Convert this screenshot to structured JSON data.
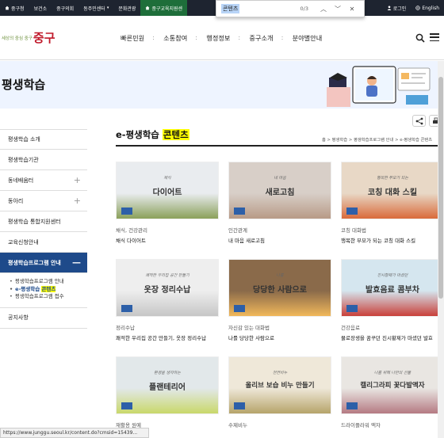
{
  "topbar": {
    "items": [
      "중구청",
      "보건소",
      "중구의회",
      "동주민센터",
      "문화관광",
      "중구교육지원센"
    ],
    "active_index": 5,
    "login": "로그인",
    "language": "English"
  },
  "find": {
    "query": "콘텐츠",
    "count": "0/3"
  },
  "header": {
    "logo_small": "세상의 중심 중구",
    "logo_big": "중구",
    "nav": [
      "빠른민원",
      "소통참여",
      "행정정보",
      "중구소개",
      "분야별안내"
    ]
  },
  "banner": {
    "title": "평생학습"
  },
  "sidebar": {
    "items": [
      {
        "label": "평생학습 소개",
        "plus": false
      },
      {
        "label": "평생학습기관",
        "plus": false
      },
      {
        "label": "동네배움터",
        "plus": true
      },
      {
        "label": "동아리",
        "plus": true
      },
      {
        "label": "평생학습 통합지원센터",
        "plus": false
      },
      {
        "label": "교육신청안내",
        "plus": false
      }
    ],
    "active": {
      "label": "평생학습프로그램 안내",
      "toggle": "—"
    },
    "sub": [
      {
        "label": "평생학습프로그램 안내"
      },
      {
        "label_pre": "e-평생학습 ",
        "label_hl": "콘텐츠"
      },
      {
        "label": "평생학습프로그램 접수"
      }
    ],
    "last": "공지사항"
  },
  "content": {
    "title_pre": "e-평생학습 ",
    "title_hl": "콘텐츠",
    "breadcrumb": "홈 > 평생학습 > 평생학습프로그램 안내 > e-평생학습 콘텐츠"
  },
  "cards": [
    {
      "cat": "채식, 건강관리",
      "name": "채식 다이어트",
      "cap": "다이어트",
      "small": "채식",
      "bg": "#e9ecef",
      "accent": "#8aa05a"
    },
    {
      "cat": "인간관계",
      "name": "내 마음 새로고침",
      "cap": "새로고침",
      "small": "내 마음",
      "bg": "#d8cfc8",
      "accent": "#b89a86"
    },
    {
      "cat": "코칭 대화법",
      "name": "행복한 부모가 되는 코칭 대화 스킬",
      "cap": "코칭 대화 스킬",
      "small": "행복한 부모가 되는",
      "bg": "#e8d8c6",
      "accent": "#d96a3a"
    },
    {
      "cat": "정리수납",
      "name": "쾌적한 우리집 공간 만들기, 옷장 정리수납",
      "cap": "옷장 정리수납",
      "small": "쾌적한 우리집 공간 만들기",
      "bg": "#eeeeee",
      "accent": "#c6c6c6"
    },
    {
      "cat": "자신감 있는 대화법",
      "name": "나를 당당한 사람으로",
      "cap": "당당한 사람으로",
      "small": "나를",
      "bg": "#8a6a4a",
      "accent": "#f1b85a"
    },
    {
      "cat": "건강음료",
      "name": "물로장생을 꿈꾸던 진시황제가 마셨던 발효",
      "cap": "발효음료 콤부차",
      "small": "진시황제가 마셨던",
      "bg": "#d5e6ef",
      "accent": "#c9403a"
    },
    {
      "cat": "재활용 원예",
      "name": "",
      "cap": "플랜테리어",
      "small": "환경을 생각하는",
      "bg": "#e2e8ea",
      "accent": "#c9d86a"
    },
    {
      "cat": "수제비누",
      "name": "",
      "cap": "올리브 보습 비누 만들기",
      "small": "천연비누",
      "bg": "#efe8d9",
      "accent": "#b6a46a"
    },
    {
      "cat": "드라이플라워 액자",
      "name": "",
      "cap": "캘리그라피 꽃다발액자",
      "small": "나를 위해 나만의 선물",
      "bg": "#e9e6e2",
      "accent": "#b57a82"
    }
  ],
  "status_url": "https://www.junggu.seoul.kr/content.do?cmsid=15439..."
}
